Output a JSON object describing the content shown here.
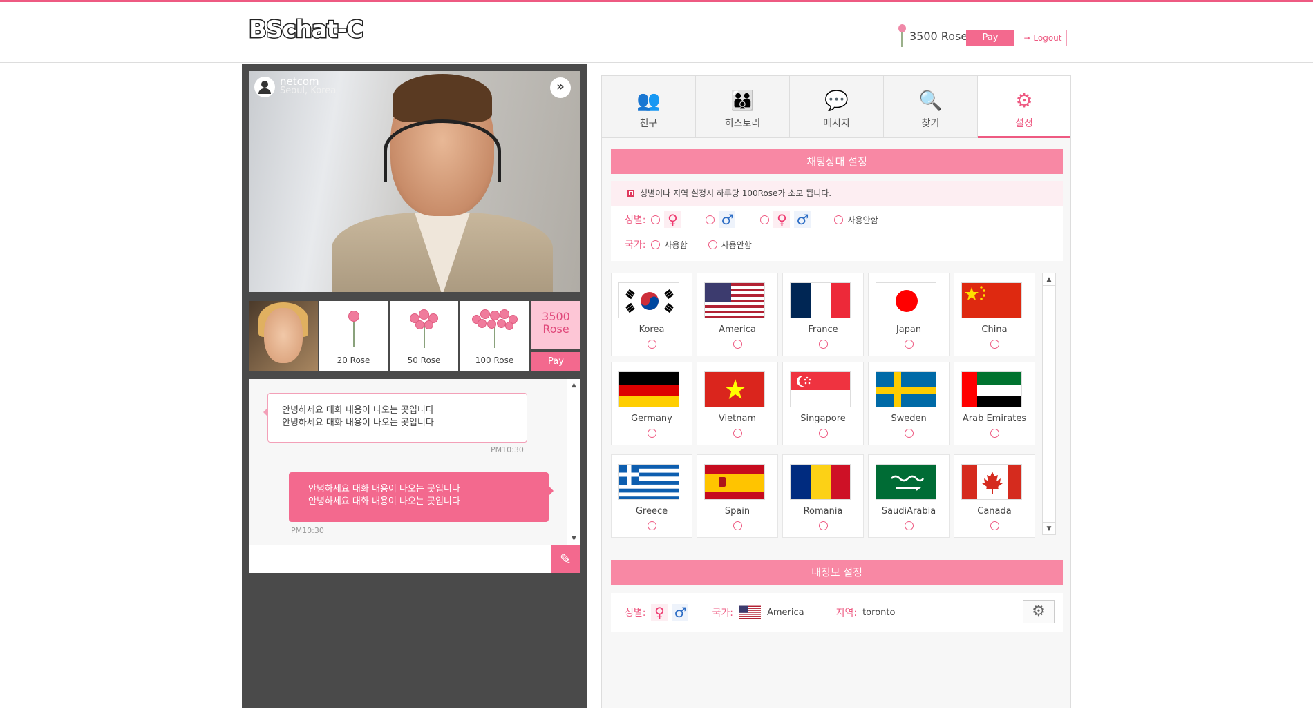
{
  "app": {
    "logo": "BSchat-C"
  },
  "header": {
    "rose_balance": "3500 Rose",
    "pay_label": "Pay",
    "logout_label": "Logout"
  },
  "video": {
    "username": "netcom",
    "location": "Seoul, Korea",
    "next_icon": "double-chevron-right-icon"
  },
  "gifts": [
    {
      "label": "20 Rose"
    },
    {
      "label": "50 Rose"
    },
    {
      "label": "100 Rose"
    }
  ],
  "rose_box": {
    "amount": "3500",
    "unit": "Rose",
    "pay_label": "Pay"
  },
  "chat": {
    "received": {
      "line1": "안녕하세요 대화 내용이 나오는 곳입니다",
      "line2": "안녕하세요 대화 내용이 나오는 곳입니다",
      "time": "PM10:30"
    },
    "sent": {
      "line1": "안녕하세요 대화 내용이 나오는 곳입니다",
      "line2": "안녕하세요 대화 내용이 나오는 곳입니다",
      "time": "PM10:30"
    },
    "input_placeholder": "",
    "send_icon": "pencil-icon"
  },
  "tabs": [
    {
      "label": "친구",
      "icon": "friends-icon"
    },
    {
      "label": "히스토리",
      "icon": "group-icon"
    },
    {
      "label": "메시지",
      "icon": "message-icon"
    },
    {
      "label": "찾기",
      "icon": "search-icon"
    },
    {
      "label": "설정",
      "icon": "gear-icon",
      "active": true
    }
  ],
  "partner_settings": {
    "title": "채팅상대 설정",
    "notice": "성별이나 지역 설정시 하루당 100Rose가 소모 됩니다.",
    "gender_label": "성별:",
    "gender_none": "사용안함",
    "country_label": "국가:",
    "country_use": "사용함",
    "country_none": "사용안함",
    "symbols": {
      "female": "♀",
      "male": "♂"
    }
  },
  "countries": [
    {
      "name": "Korea",
      "flag": "korea"
    },
    {
      "name": "America",
      "flag": "usa"
    },
    {
      "name": "France",
      "flag": "france"
    },
    {
      "name": "Japan",
      "flag": "japan"
    },
    {
      "name": "China",
      "flag": "china"
    },
    {
      "name": "Germany",
      "flag": "germany"
    },
    {
      "name": "Vietnam",
      "flag": "vietnam"
    },
    {
      "name": "Singapore",
      "flag": "singapore"
    },
    {
      "name": "Sweden",
      "flag": "sweden"
    },
    {
      "name": "Arab Emirates",
      "flag": "uae"
    },
    {
      "name": "Greece",
      "flag": "greece"
    },
    {
      "name": "Spain",
      "flag": "spain"
    },
    {
      "name": "Romania",
      "flag": "romania"
    },
    {
      "name": "SaudiArabia",
      "flag": "saudi"
    },
    {
      "name": "Canada",
      "flag": "canada"
    }
  ],
  "my_info": {
    "title": "내정보 설정",
    "gender_label": "성별:",
    "country_label": "국가:",
    "country_value": "America",
    "region_label": "지역:",
    "region_value": "toronto"
  },
  "colors": {
    "accent": "#ee5a82",
    "accent_light": "#f888a4",
    "panel_dark": "#4a4a4a"
  }
}
